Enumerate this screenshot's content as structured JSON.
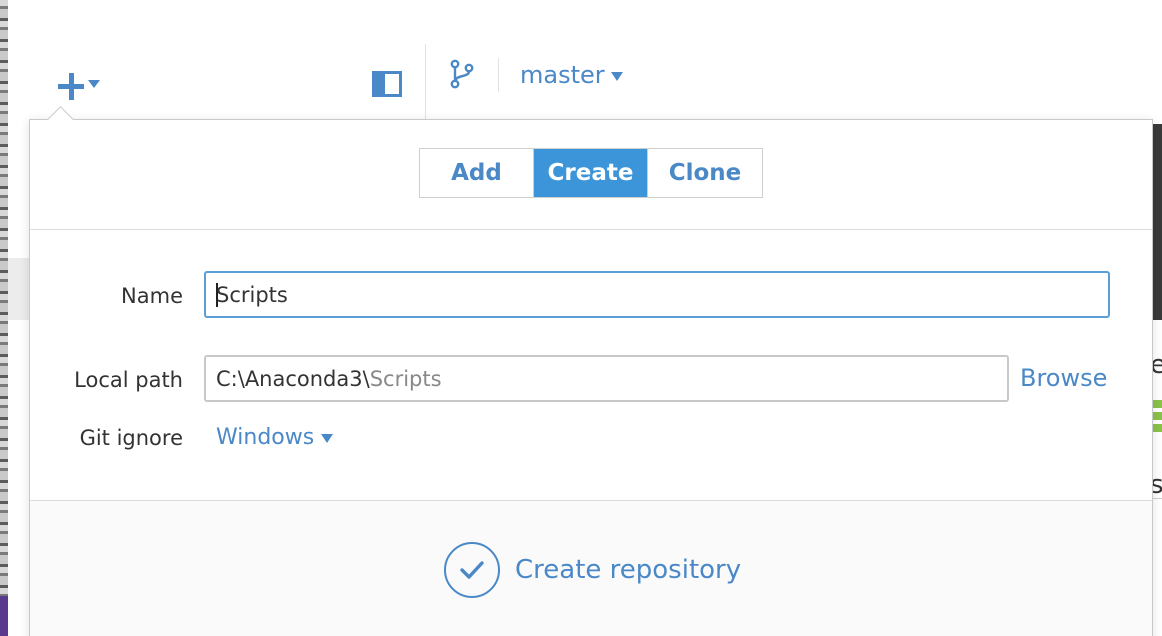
{
  "toolbar": {
    "branch": "master"
  },
  "tabs": [
    {
      "label": "Add",
      "active": false
    },
    {
      "label": "Create",
      "active": true
    },
    {
      "label": "Clone",
      "active": false
    }
  ],
  "form": {
    "name_label": "Name",
    "name_value": "Scripts",
    "path_label": "Local path",
    "path_base": "C:\\Anaconda3\\",
    "path_tail": "Scripts",
    "browse_label": "Browse",
    "gitignore_label": "Git ignore",
    "gitignore_value": "Windows"
  },
  "footer": {
    "create_label": "Create repository"
  },
  "peek": {
    "right_text_1": "es",
    "right_text_2": "s"
  },
  "colors": {
    "accent": "#4a88c7",
    "active_tab": "#3d95d9",
    "focus_border": "#5b9fd6"
  },
  "icons": [
    "plus-icon",
    "caret-down-icon",
    "sidebar-toggle-icon",
    "branch-icon",
    "checkmark-icon"
  ]
}
